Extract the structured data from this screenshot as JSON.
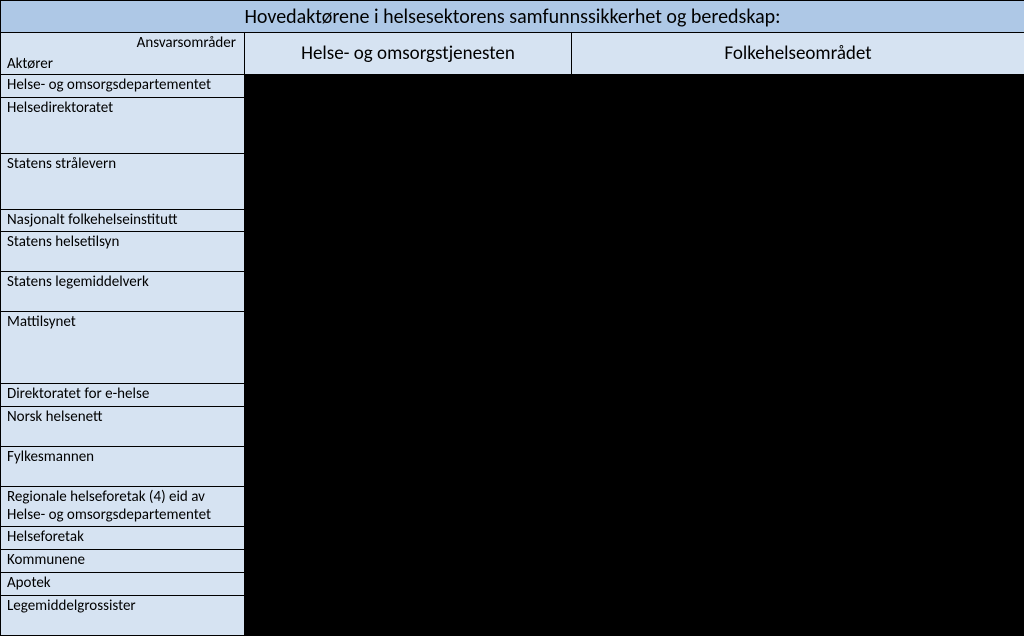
{
  "title": "Hovedaktørene i helsesektorens samfunnssikkerhet og beredskap:",
  "col_headers": {
    "ansvar_top": "Ansvarsområder",
    "ansvar_bot": "Aktører",
    "c1": "Helse- og omsorgstjenesten",
    "c2": "Folkehelseområdet"
  },
  "rows": [
    {
      "label": "Helse- og omsorgsdepartementet"
    },
    {
      "label": "Helsedirektoratet"
    },
    {
      "label": "Statens strålevern"
    },
    {
      "label": "Nasjonalt folkehelseinstitutt"
    },
    {
      "label": "Statens helsetilsyn"
    },
    {
      "label": "Statens legemiddelverk"
    },
    {
      "label": "Mattilsynet"
    },
    {
      "label": "Direktoratet for e-helse"
    },
    {
      "label": "Norsk helsenett"
    },
    {
      "label": "Fylkesmannen"
    },
    {
      "label": "Regionale helseforetak (4) eid av Helse- og omsorgsdepartementet"
    },
    {
      "label": "Helseforetak"
    },
    {
      "label": "Kommunene"
    },
    {
      "label": "Apotek"
    },
    {
      "label": "Legemiddelgrossister"
    }
  ]
}
